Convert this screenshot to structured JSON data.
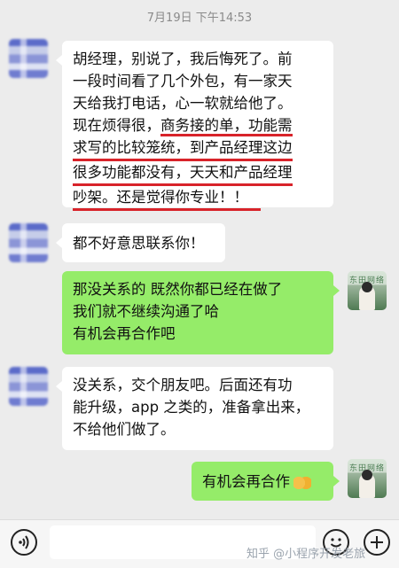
{
  "timestamp": "7月19日 下午14:53",
  "messages": [
    {
      "from": "contact",
      "lines": [
        "胡经理，别说了，我后悔死了。前",
        "一段时间看了几个外包，有一家天",
        "天给我打电话，心一软就给他了。",
        "现在烦得很，商务接的单，功能需",
        "求写的比较笼统，到产品经理这边",
        "很多功能都没有，天天和产品经理",
        "吵架。还是觉得你专业！！"
      ]
    },
    {
      "from": "contact",
      "lines": [
        "都不好意思联系你！"
      ]
    },
    {
      "from": "self",
      "lines": [
        "那没关系的 既然你都已经在做了",
        "我们就不继续沟通了哈",
        "有机会再合作吧"
      ]
    },
    {
      "from": "contact",
      "lines": [
        "没关系，交个朋友吧。后面还有功",
        "能升级，app 之类的，准备拿出来，",
        "不给他们做了。"
      ]
    },
    {
      "from": "self",
      "lines": [
        "有机会再合作"
      ],
      "emoji": "handshake-emoji"
    }
  ],
  "self_avatar_watermark": "东田网络",
  "watermark": "知乎 @小程序开发老旅",
  "icons": {
    "voice": "voice-icon",
    "emoji": "emoji-icon",
    "plus": "plus-icon"
  }
}
